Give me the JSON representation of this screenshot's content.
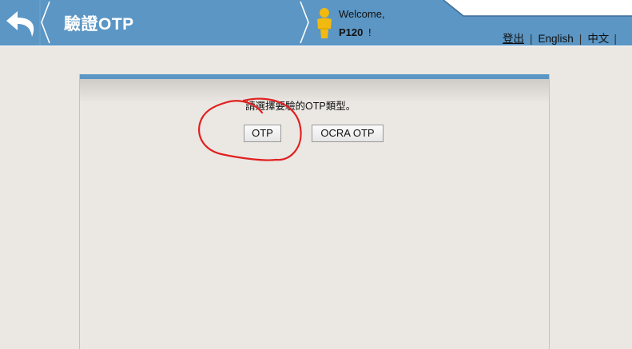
{
  "header": {
    "back_icon": "back-arrow-icon",
    "title": "驗證OTP",
    "user_icon": "user-figure-icon",
    "welcome": "Welcome,",
    "username": "P120",
    "username_suffix": "!",
    "links": {
      "logout": "登出",
      "separator": "|",
      "english": "English",
      "chinese": "中文"
    }
  },
  "content": {
    "prompt": "請選擇要驗的OTP類型。",
    "buttons": {
      "otp": "OTP",
      "ocra_otp": "OCRA OTP"
    }
  },
  "annotation": {
    "color": "#e02020"
  },
  "colors": {
    "header_blue": "#5b96c4",
    "background": "#ebe7e3",
    "user_icon": "#f2b90f"
  }
}
